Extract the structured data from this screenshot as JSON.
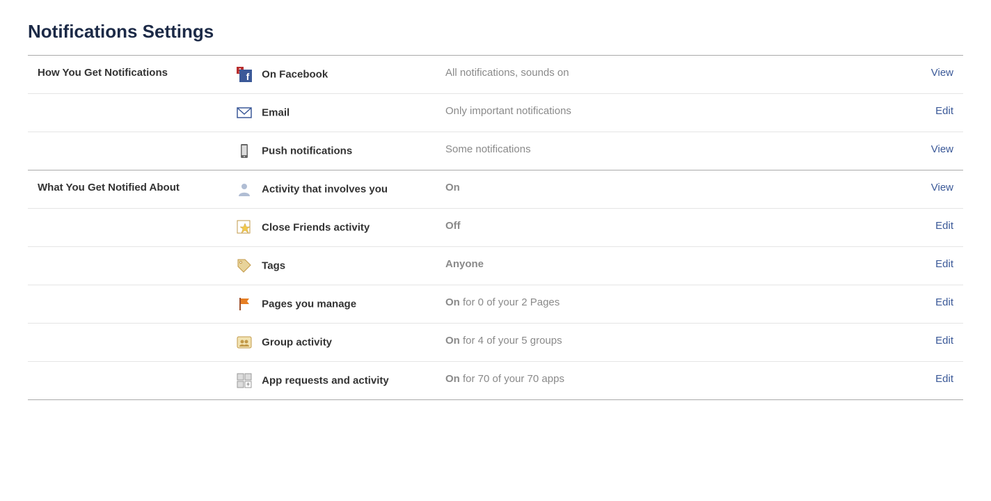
{
  "pageTitle": "Notifications Settings",
  "sections": {
    "howYouGet": {
      "heading": "How You Get Notifications",
      "items": [
        {
          "label": "On Facebook",
          "status_strong": "",
          "status_rest": "All notifications, sounds on",
          "action": "View",
          "icon": "facebook"
        },
        {
          "label": "Email",
          "status_strong": "",
          "status_rest": "Only important notifications",
          "action": "Edit",
          "icon": "email"
        },
        {
          "label": "Push notifications",
          "status_strong": "",
          "status_rest": "Some notifications",
          "action": "View",
          "icon": "mobile"
        }
      ]
    },
    "whatAbout": {
      "heading": "What You Get Notified About",
      "items": [
        {
          "label": "Activity that involves you",
          "status_strong": "On",
          "status_rest": "",
          "action": "View",
          "icon": "person"
        },
        {
          "label": "Close Friends activity",
          "status_strong": "Off",
          "status_rest": "",
          "action": "Edit",
          "icon": "star"
        },
        {
          "label": "Tags",
          "status_strong": "Anyone",
          "status_rest": "",
          "action": "Edit",
          "icon": "tag"
        },
        {
          "label": "Pages you manage",
          "status_strong": "On",
          "status_rest": " for 0 of your 2 Pages",
          "action": "Edit",
          "icon": "flag"
        },
        {
          "label": "Group activity",
          "status_strong": "On",
          "status_rest": " for 4 of your 5 groups",
          "action": "Edit",
          "icon": "group"
        },
        {
          "label": "App requests and activity",
          "status_strong": "On",
          "status_rest": " for 70 of your 70 apps",
          "action": "Edit",
          "icon": "apps"
        }
      ]
    }
  }
}
